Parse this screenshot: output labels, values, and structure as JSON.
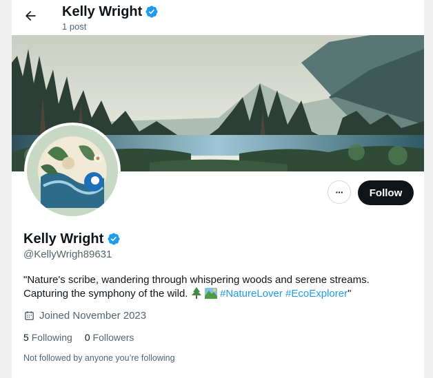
{
  "header": {
    "name": "Kelly Wright",
    "post_count": "1 post"
  },
  "profile": {
    "display_name": "Kelly Wright",
    "handle": "@KellyWrigh89631",
    "bio_text": "\"Nature's scribe, wandering through whispering woods and serene streams. Capturing the symphony of the wild.",
    "bio_hashtags": [
      "#NatureLover",
      "#EcoExplorer"
    ],
    "bio_end": "\"",
    "joined": "Joined November 2023",
    "following_count": "5",
    "following_label": "Following",
    "followers_count": "0",
    "followers_label": "Followers",
    "not_followed": "Not followed by anyone you’re following"
  },
  "actions": {
    "more_label": "···",
    "follow_label": "Follow"
  },
  "icons": {
    "back": "back-arrow-icon",
    "verified": "verified-badge-icon",
    "calendar": "calendar-icon",
    "emoji_tree": "evergreen-tree-emoji",
    "emoji_park": "national-park-emoji"
  },
  "colors": {
    "accent": "#1d9bf0",
    "follow_button": "#0f1419",
    "muted_text": "#536471"
  }
}
